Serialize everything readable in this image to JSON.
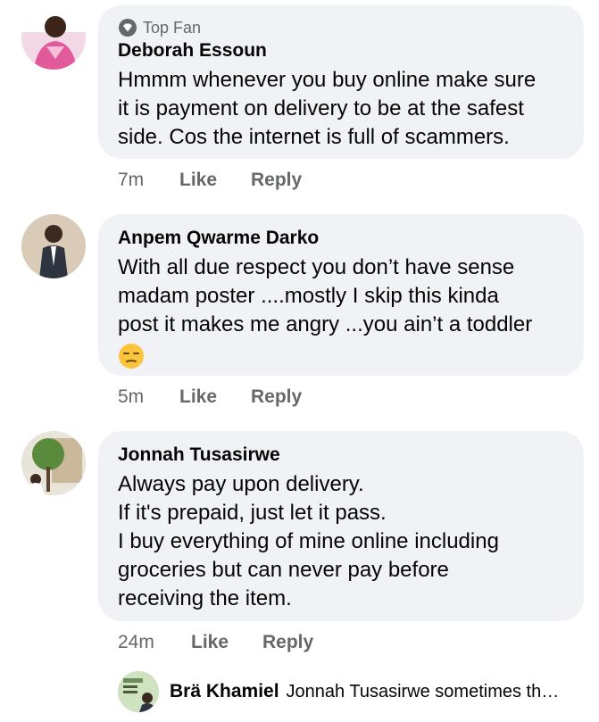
{
  "comments": [
    {
      "badge": "Top Fan",
      "author": "Deborah Essoun",
      "text": "Hmmm whenever you buy online make sure\nit is payment on delivery to be at the safest\nside. Cos the internet is full of scammers.",
      "time": "7m",
      "like": "Like",
      "reply": "Reply"
    },
    {
      "author": "Anpem Qwarme Darko",
      "text": "With all due respect you don’t have sense\nmadam poster ....mostly I skip this kinda\npost it makes me angry ...you ain’t a toddler",
      "emoji": "unamused-face",
      "time": "5m",
      "like": "Like",
      "reply": "Reply"
    },
    {
      "author": "Jonnah Tusasirwe",
      "text": "Always pay upon delivery.\nIf it's prepaid, just let it pass.\nI buy everything of mine online including\ngroceries but can never pay before\nreceiving the item.",
      "time": "24m",
      "like": "Like",
      "reply": "Reply"
    }
  ],
  "reply_preview": {
    "author": "Brä Khamiel",
    "text": "Jonnah Tusasirwe sometimes th…"
  },
  "colors": {
    "bubble": "#f0f2f5",
    "secondary_text": "#65676b",
    "primary_text": "#050505"
  }
}
